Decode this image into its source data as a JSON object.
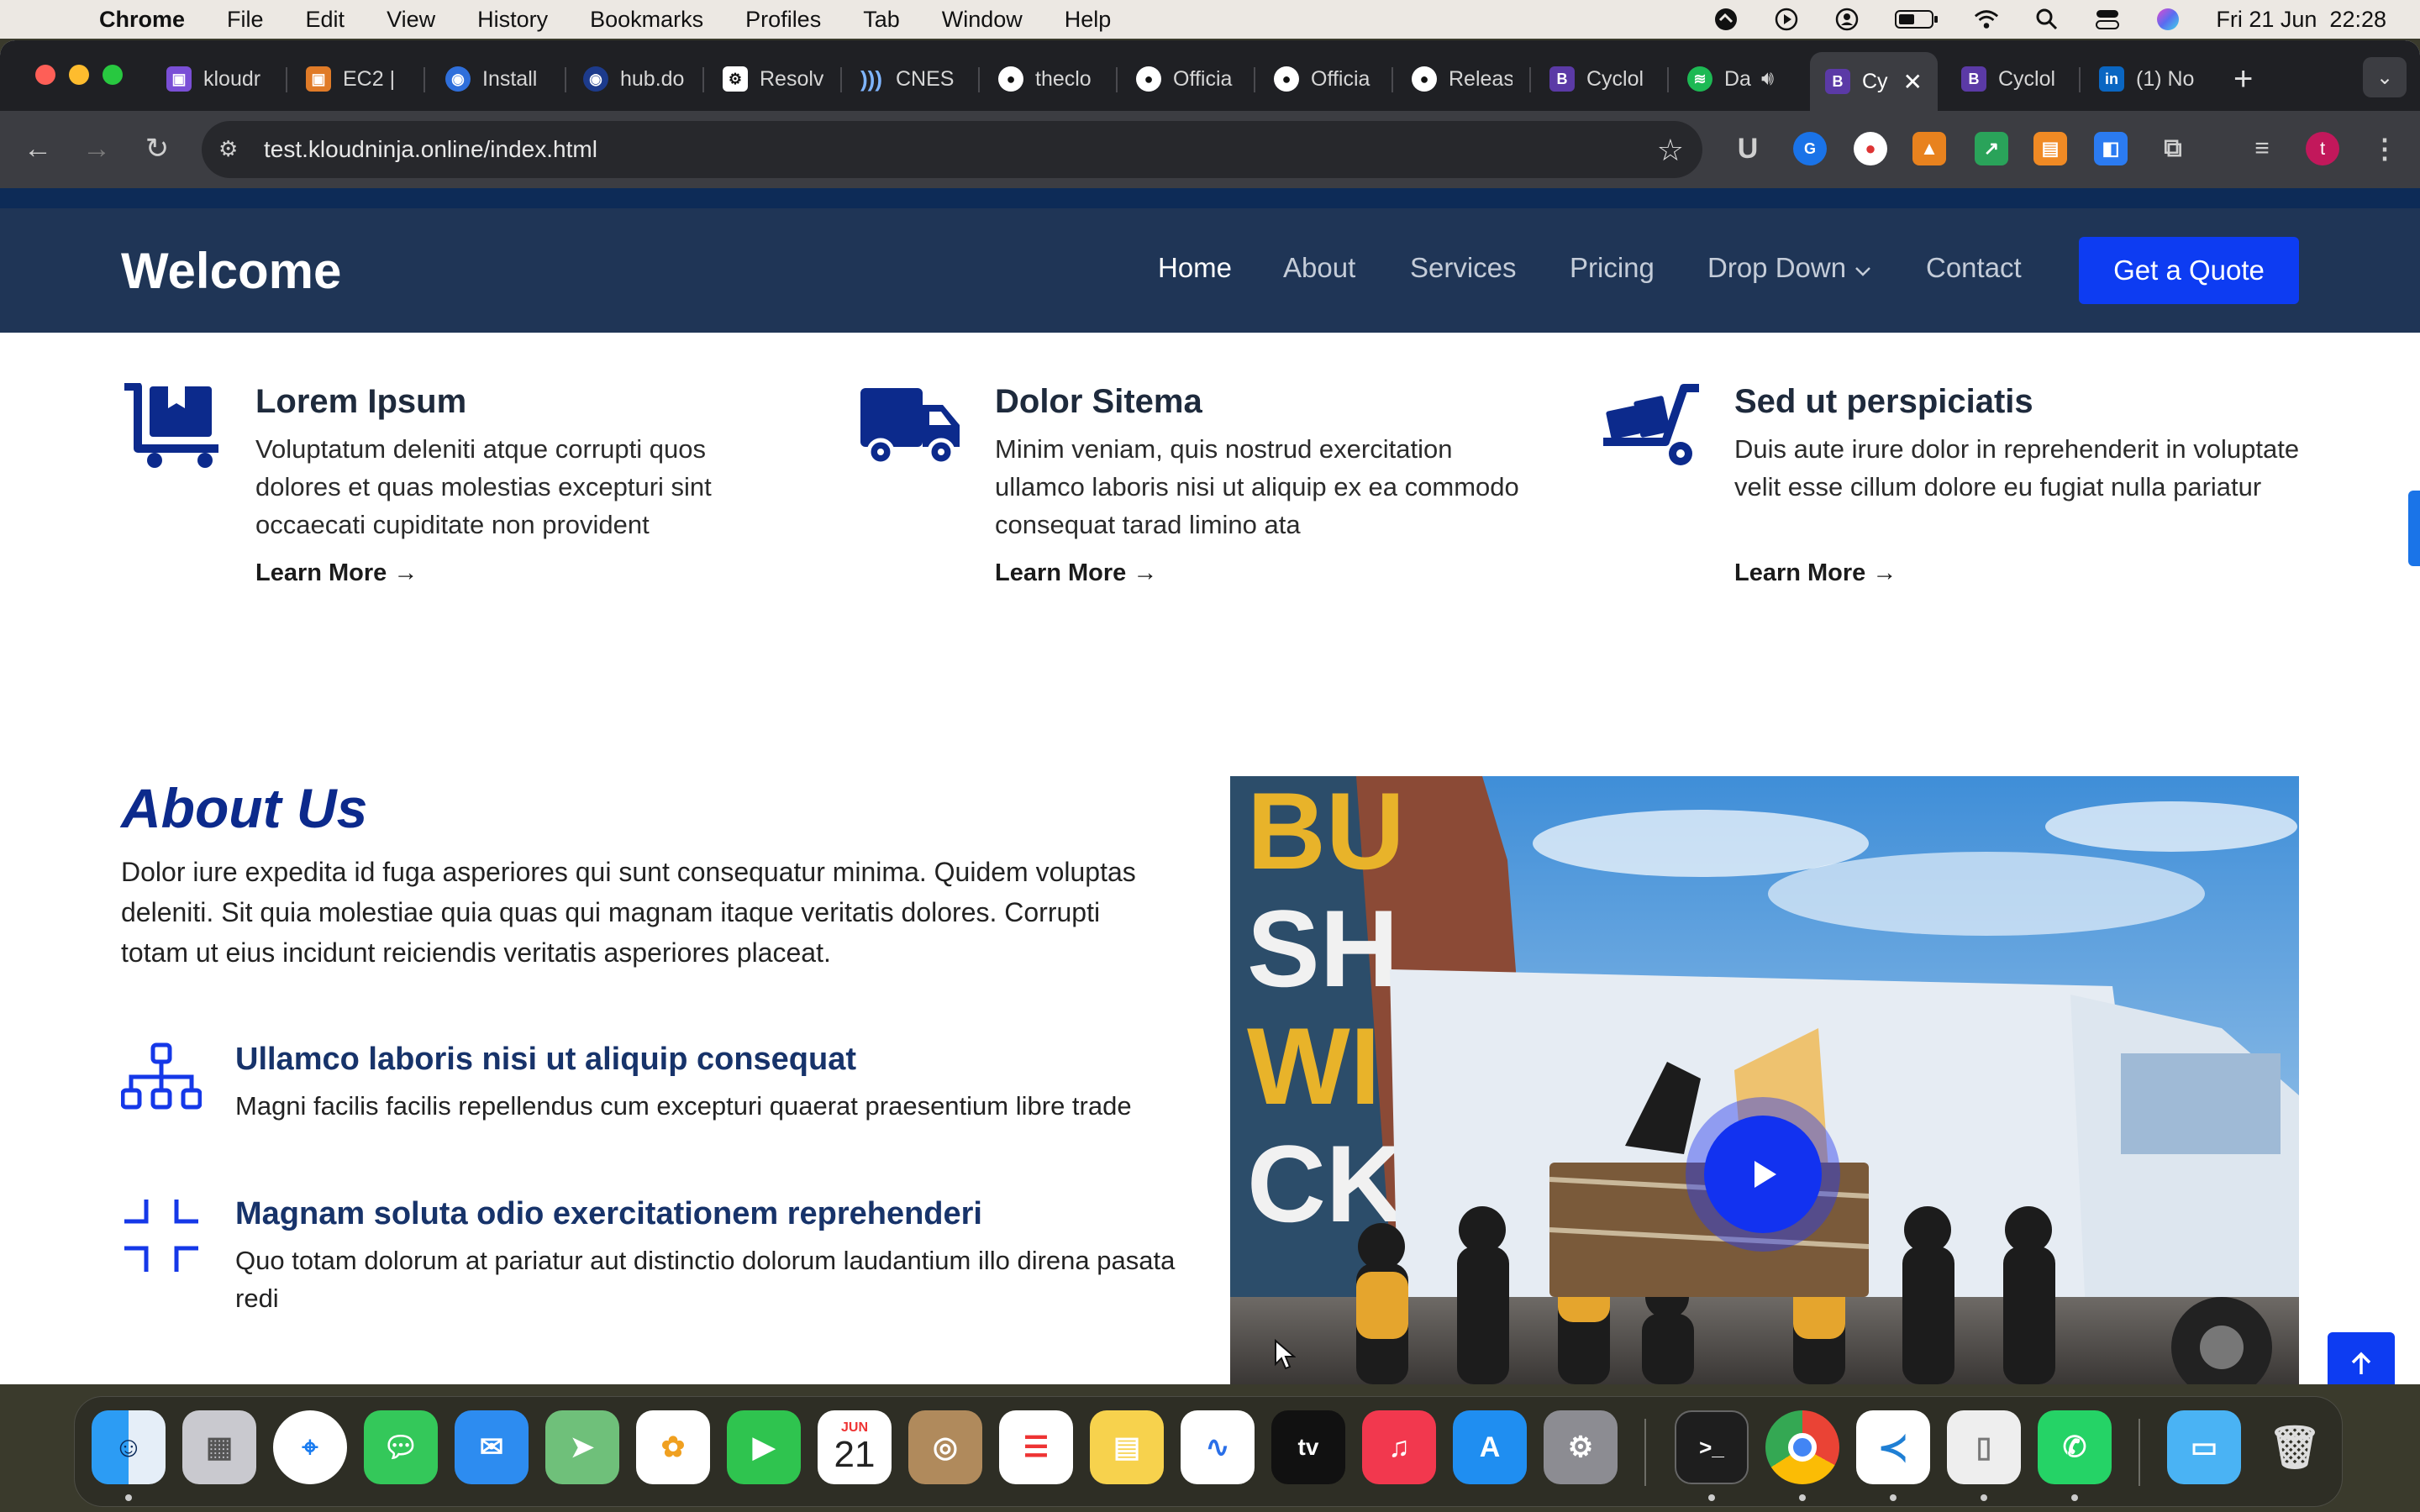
{
  "menubar": {
    "app": "Chrome",
    "items": [
      "File",
      "Edit",
      "View",
      "History",
      "Bookmarks",
      "Profiles",
      "Tab",
      "Window",
      "Help"
    ],
    "clock": "Fri 21 Jun  22:28"
  },
  "tabs": [
    {
      "title": "kloudr",
      "fav_color": "#7a4fd6",
      "fav": "▣"
    },
    {
      "title": "EC2 | ",
      "fav_color": "#e07b28",
      "fav": "▣"
    },
    {
      "title": "Install",
      "fav_color": "#2f6fdb",
      "fav": "◉"
    },
    {
      "title": "hub.do",
      "fav_color": "#1d3b8c",
      "fav": "◉"
    },
    {
      "title": "Resolv",
      "fav_color": "#ffffff",
      "fav": "⚙"
    },
    {
      "title": "CNES",
      "fav_color": "#1f2024",
      "fav": ")"
    },
    {
      "title": "theclo",
      "fav_color": "#1f2024",
      "fav": "●"
    },
    {
      "title": "Officia",
      "fav_color": "#1f2024",
      "fav": "●"
    },
    {
      "title": "Officia",
      "fav_color": "#1f2024",
      "fav": "●"
    },
    {
      "title": "Releas",
      "fav_color": "#1f2024",
      "fav": "●"
    },
    {
      "title": "Cyclol",
      "fav_color": "#5b3aa6",
      "fav": "B"
    },
    {
      "title": "Da",
      "fav_color": "#1db954",
      "fav": "◉"
    },
    {
      "title": "Cy",
      "fav_color": "#5b3aa6",
      "fav": "B"
    },
    {
      "title": "Cyclol",
      "fav_color": "#5b3aa6",
      "fav": "B"
    },
    {
      "title": "(1) No",
      "fav_color": "#0a66c2",
      "fav": "in"
    }
  ],
  "address": {
    "url": "test.kloudninja.online/index.html"
  },
  "site": {
    "logo": "Welcome",
    "nav": [
      "Home",
      "About",
      "Services",
      "Pricing",
      "Drop Down",
      "Contact"
    ],
    "dropdown_chevron": "chevron-down-icon",
    "cta": "Get a Quote"
  },
  "features": [
    {
      "icon": "cart-icon",
      "title": "Lorem Ipsum",
      "text": "Voluptatum deleniti atque corrupti quos dolores et quas molestias excepturi sint occaecati cupiditate non provident",
      "link": "Learn More"
    },
    {
      "icon": "truck-icon",
      "title": "Dolor Sitema",
      "text": "Minim veniam, quis nostrud exercitation ullamco laboris nisi ut aliquip ex ea commodo consequat tarad limino ata",
      "link": "Learn More"
    },
    {
      "icon": "dolly-icon",
      "title": "Sed ut perspiciatis",
      "text": "Duis aute irure dolor in reprehenderit in voluptate velit esse cillum dolore eu fugiat nulla pariatur",
      "link": "Learn More"
    }
  ],
  "about": {
    "title": "About Us",
    "text": "Dolor iure expedita id fuga asperiores qui sunt consequatur minima. Quidem voluptas deleniti. Sit quia molestiae quia quas qui magnam itaque veritatis dolores. Corrupti totam ut eius incidunt reiciendis veritatis asperiores placeat.",
    "items": [
      {
        "icon": "diagram-icon",
        "title": "Ullamco laboris nisi ut aliquip consequat",
        "text": "Magni facilis facilis repellendus cum excepturi quaerat praesentium libre trade"
      },
      {
        "icon": "fullscreen-exit-icon",
        "title": "Magnam soluta odio exercitationem reprehenderi",
        "text": "Quo totam dolorum at pariatur aut distinctio dolorum laudantium illo direna pasata redi"
      }
    ]
  },
  "dock": {
    "calendar_month": "JUN",
    "calendar_day": "21"
  },
  "colors": {
    "brand_blue": "#0d3cf2",
    "nav_bg": "#1f3556",
    "heading_blue": "#0c2a8c"
  }
}
